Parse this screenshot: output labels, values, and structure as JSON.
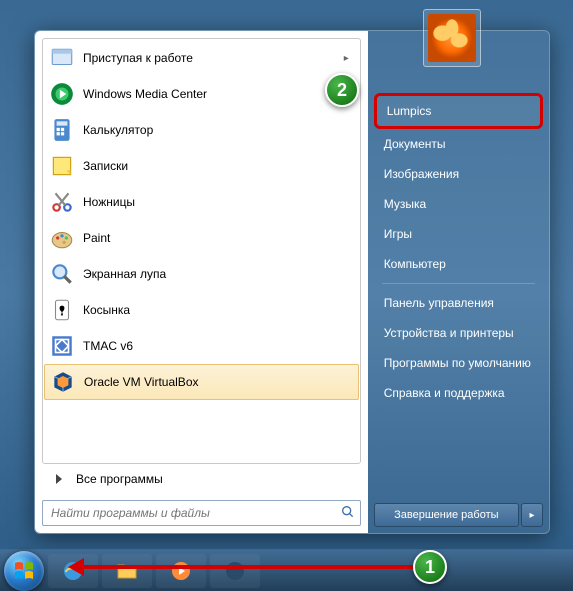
{
  "annotations": {
    "one": "1",
    "two": "2"
  },
  "left": {
    "programs": [
      {
        "label": "Приступая к работе",
        "has_arrow": true
      },
      {
        "label": "Windows Media Center",
        "has_arrow": false
      },
      {
        "label": "Калькулятор",
        "has_arrow": false
      },
      {
        "label": "Записки",
        "has_arrow": false
      },
      {
        "label": "Ножницы",
        "has_arrow": false
      },
      {
        "label": "Paint",
        "has_arrow": false
      },
      {
        "label": "Экранная лупа",
        "has_arrow": false
      },
      {
        "label": "Косынка",
        "has_arrow": false
      },
      {
        "label": "TMAC v6",
        "has_arrow": false
      },
      {
        "label": "Oracle VM VirtualBox",
        "has_arrow": false
      }
    ],
    "all_programs": "Все программы",
    "search_placeholder": "Найти программы и файлы"
  },
  "right": {
    "user": "Lumpics",
    "items_top": [
      "Документы",
      "Изображения",
      "Музыка",
      "Игры",
      "Компьютер"
    ],
    "items_bottom": [
      "Панель управления",
      "Устройства и принтеры",
      "Программы по умолчанию",
      "Справка и поддержка"
    ],
    "shutdown": "Завершение работы"
  }
}
